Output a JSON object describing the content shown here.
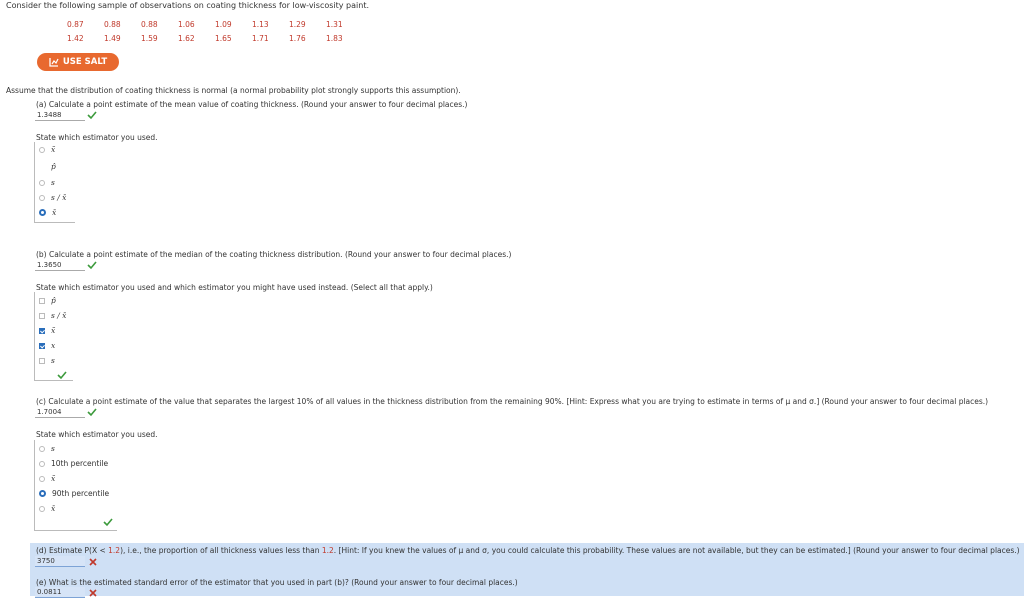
{
  "intro": "Consider the following sample of observations on coating thickness for low-viscosity paint.",
  "data_row1": [
    "0.87",
    "0.88",
    "0.88",
    "1.06",
    "1.09",
    "1.13",
    "1.29",
    "1.31"
  ],
  "data_row2": [
    "1.42",
    "1.49",
    "1.59",
    "1.62",
    "1.65",
    "1.71",
    "1.76",
    "1.83"
  ],
  "salt_label": "USE SALT",
  "assume": "Assume that the distribution of coating thickness is normal (a normal probability plot strongly supports this assumption).",
  "a": {
    "question": "(a) Calculate a point estimate of the mean value of coating thickness. (Round your answer to four decimal places.)",
    "answer": "1.3488",
    "state": "State which estimator you used.",
    "options": [
      "x̃",
      "p̂",
      "s",
      "s / x̄",
      "x̄"
    ]
  },
  "b": {
    "question": "(b) Calculate a point estimate of the median of the coating thickness distribution. (Round your answer to four decimal places.)",
    "answer": "1.3650",
    "state": "State which estimator you used and which estimator you might have used instead. (Select all that apply.)",
    "options": [
      "p̂",
      "s / x̄",
      "x̃",
      "x",
      "s"
    ]
  },
  "c": {
    "question": "(c) Calculate a point estimate of the value that separates the largest 10% of all values in the thickness distribution from the remaining 90%. [Hint: Express what you are trying to estimate in terms of μ and σ.] (Round your answer to four decimal places.)",
    "answer": "1.7004",
    "state": "State which estimator you used.",
    "options": [
      "s",
      "10th percentile",
      "x̃",
      "90th percentile",
      "x̄"
    ]
  },
  "d": {
    "prefix": "(d) Estimate P(X < ",
    "red": "1.2",
    "mid": "), i.e., the proportion of all thickness values less than ",
    "red2": "1.2",
    "suffix": ". [Hint: If you knew the values of μ and σ, you could calculate this probability. These values are not available, but they can be estimated.] (Round your answer to four decimal places.)",
    "answer": "3750"
  },
  "e": {
    "question": "(e) What is the estimated standard error of the estimator that you used in part (b)? (Round your answer to four decimal places.)",
    "answer": "0.0811"
  },
  "colors": {
    "accent": "#2a6ebb",
    "salt": "#e8692f",
    "correct": "#3c9a3c",
    "wrong": "#c0392b"
  }
}
